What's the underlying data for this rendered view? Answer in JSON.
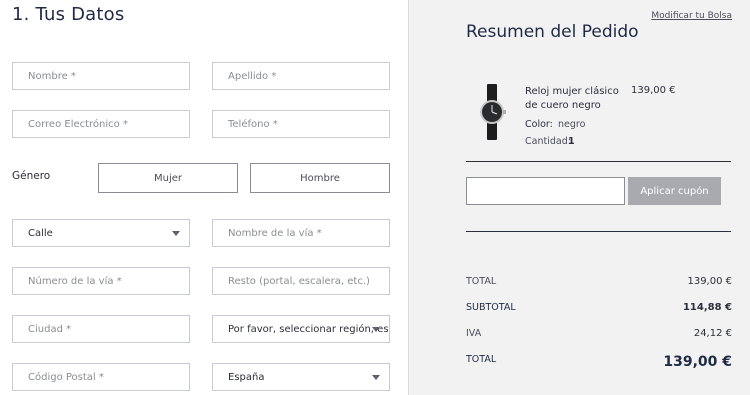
{
  "form": {
    "section_title": "1. Tus Datos",
    "nombre_placeholder": "Nombre *",
    "apellido_placeholder": "Apellido *",
    "correo_placeholder": "Correo Electrónico *",
    "telefono_placeholder": "Teléfono *",
    "genero_label": "Género",
    "genero_options": [
      "Mujer",
      "Hombre"
    ],
    "calle_value": "Calle",
    "via_nombre_placeholder": "Nombre de la vía *",
    "via_numero_placeholder": "Número de la vía *",
    "resto_placeholder": "Resto (portal, escalera, etc.)",
    "ciudad_placeholder": "Ciudad *",
    "region_value": "Por favor, seleccionar región, es",
    "postal_placeholder": "Código Postal *",
    "pais_value": "España"
  },
  "summary": {
    "modify_link": "Modificar tu Bolsa",
    "title": "Resumen del Pedido",
    "product": {
      "name": "Reloj mujer clásico de cuero negro",
      "price": "139,00 €",
      "color_label": "Color:",
      "color_value": "negro",
      "qty_label": "Cantidad:",
      "qty_value": "1"
    },
    "coupon_button": "Aplicar cupón",
    "rows": [
      {
        "label": "TOTAL",
        "value": "139,00 €"
      },
      {
        "label": "SUBTOTAL",
        "value": "114,88 €"
      },
      {
        "label": "IVA",
        "value": "24,12 €"
      },
      {
        "label": "TOTAL",
        "value": "139,00 €"
      }
    ]
  }
}
